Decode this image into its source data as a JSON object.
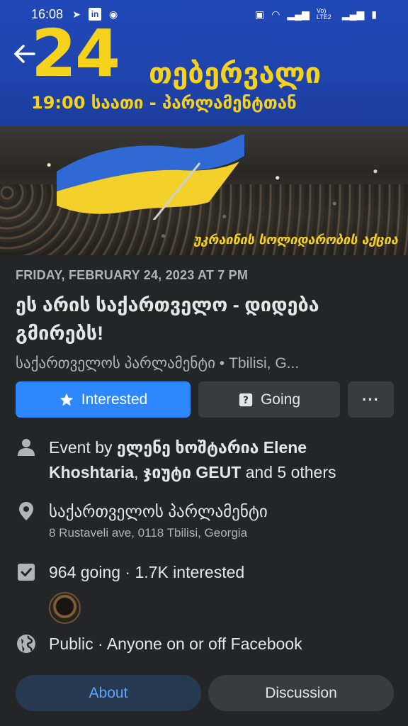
{
  "status_bar": {
    "time": "16:08",
    "network": "Vo) LTE2"
  },
  "cover": {
    "date_number": "24",
    "month": "თებერვალი",
    "time_place": "19:00 საათი - პარლამენტთან",
    "solidarity_text": "უკრაინის სოლიდარობის აქცია"
  },
  "event": {
    "datetime": "FRIDAY, FEBRUARY 24, 2023 AT 7 PM",
    "title": "ეს არის საქართველო - დიდება გმირებს!",
    "location_line": "საქართველოს პარლამენტი • Tbilisi, G..."
  },
  "actions": {
    "interested_label": "Interested",
    "going_label": "Going",
    "more_label": "···"
  },
  "details": {
    "event_by_prefix": "Event by ",
    "host1": "ელენე ხოშტარია Elene Khoshtaria",
    "sep": ", ",
    "host2": "ჯიუტი GEUT",
    "hosts_suffix": " and 5 others",
    "venue_name": "საქართველოს პარლამენტი",
    "venue_address": "8 Rustaveli ave, 0118 Tbilisi, Georgia",
    "attendance": "964 going · 1.7K interested",
    "privacy": "Public · Anyone on or off Facebook"
  },
  "tabs": {
    "about": "About",
    "discussion": "Discussion"
  },
  "colors": {
    "accent": "#2d88ff",
    "banner_blue": "#2148b8",
    "banner_yellow": "#f5d21c"
  }
}
